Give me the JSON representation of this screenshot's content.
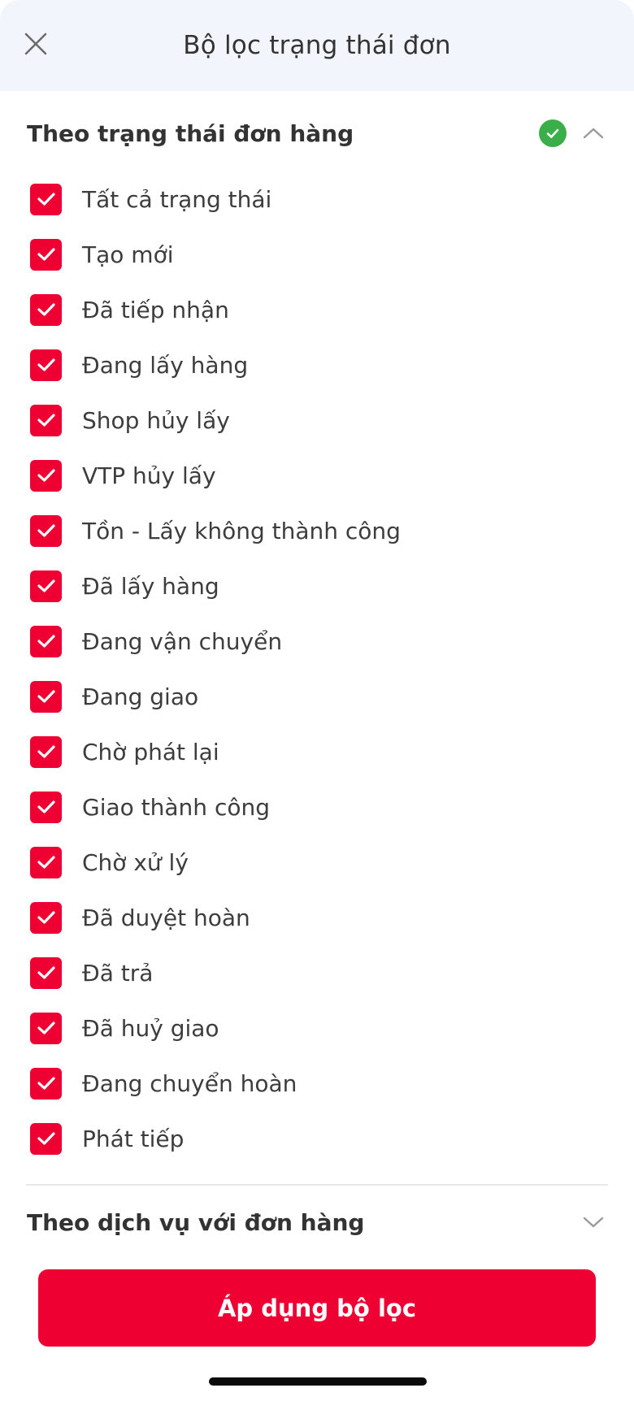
{
  "header": {
    "title": "Bộ lọc trạng thái đơn",
    "close_icon": "close-icon"
  },
  "status_section": {
    "title": "Theo trạng thái đơn hàng",
    "expanded": true,
    "complete": true,
    "items": [
      {
        "label": "Tất cả trạng thái",
        "checked": true
      },
      {
        "label": "Tạo mới",
        "checked": true
      },
      {
        "label": "Đã tiếp nhận",
        "checked": true
      },
      {
        "label": "Đang lấy hàng",
        "checked": true
      },
      {
        "label": "Shop hủy lấy",
        "checked": true
      },
      {
        "label": "VTP hủy lấy",
        "checked": true
      },
      {
        "label": "Tồn - Lấy không thành công",
        "checked": true
      },
      {
        "label": "Đã lấy hàng",
        "checked": true
      },
      {
        "label": "Đang vận chuyển",
        "checked": true
      },
      {
        "label": "Đang giao",
        "checked": true
      },
      {
        "label": "Chờ phát lại",
        "checked": true
      },
      {
        "label": "Giao thành công",
        "checked": true
      },
      {
        "label": "Chờ xử lý",
        "checked": true
      },
      {
        "label": "Đã duyệt hoàn",
        "checked": true
      },
      {
        "label": "Đã trả",
        "checked": true
      },
      {
        "label": "Đã huỷ giao",
        "checked": true
      },
      {
        "label": "Đang chuyển hoàn",
        "checked": true
      },
      {
        "label": "Phát tiếp",
        "checked": true
      }
    ]
  },
  "service_section": {
    "title": "Theo dịch vụ với đơn hàng",
    "expanded": false
  },
  "footer": {
    "apply_label": "Áp dụng bộ lọc"
  },
  "colors": {
    "accent": "#ee0033",
    "success": "#3aae48",
    "header_bg": "#f2f6fc",
    "text": "#333333"
  }
}
